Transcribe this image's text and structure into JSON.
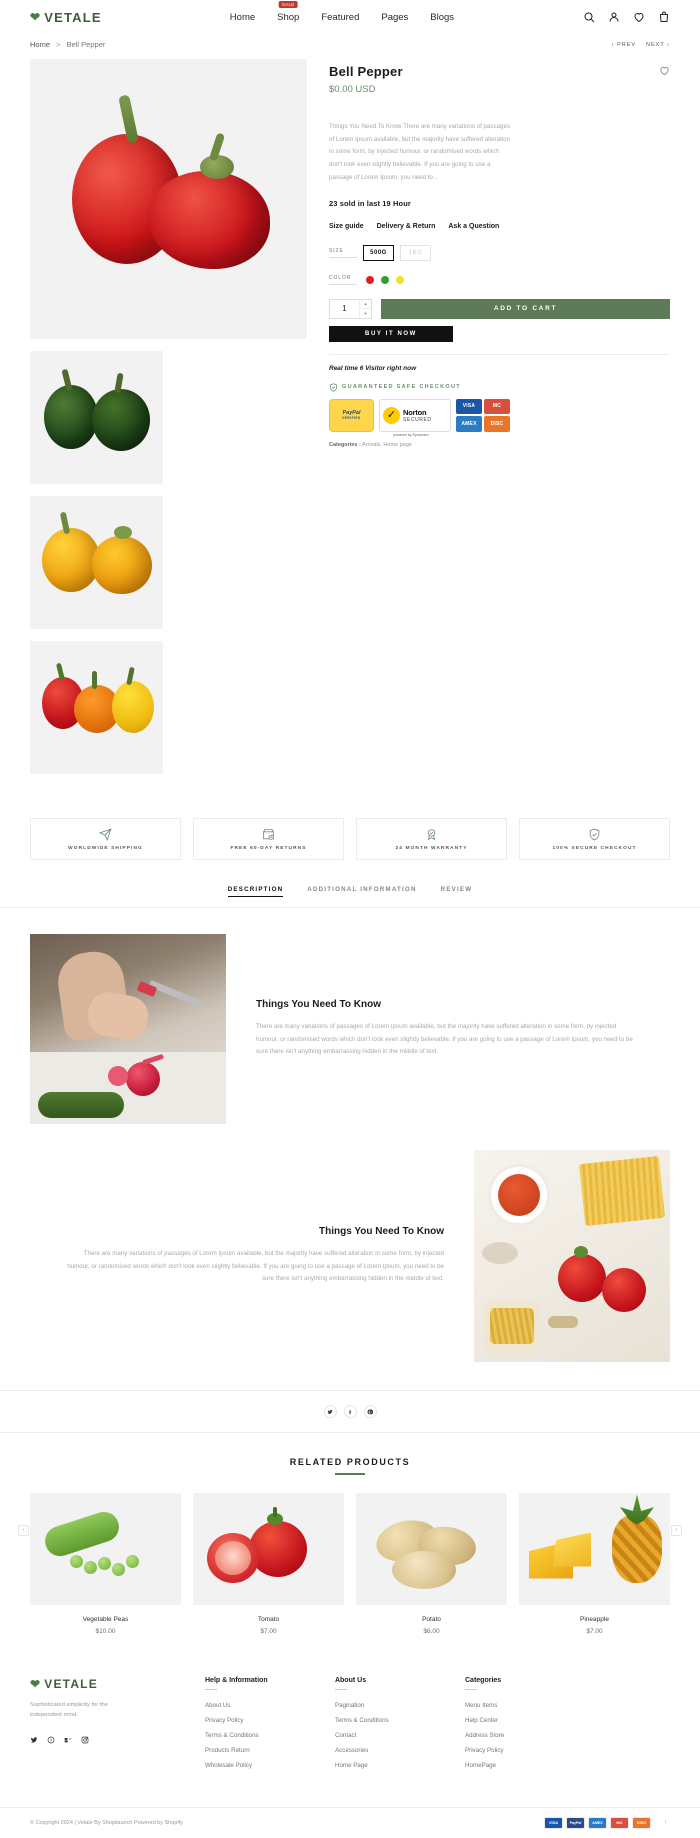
{
  "header": {
    "logo": "VETALE",
    "nav": [
      {
        "label": "Home",
        "badge": ""
      },
      {
        "label": "Shop",
        "badge": "SALE"
      },
      {
        "label": "Featured",
        "badge": ""
      },
      {
        "label": "Pages",
        "badge": ""
      },
      {
        "label": "Blogs",
        "badge": ""
      }
    ],
    "icons": [
      "search-icon",
      "account-icon",
      "wishlist-icon",
      "cart-icon"
    ]
  },
  "breadcrumb": {
    "home": "Home",
    "separator": ">",
    "current": "Bell Pepper",
    "prev": "PREV",
    "next": "NEXT"
  },
  "product": {
    "title": "Bell Pepper",
    "price": "$0.00 USD",
    "description": "Things You Need To Know There are many variations of passages of Lorem Ipsum available, but the majority have suffered alteration in some form, by injected humour, or randomised words which don't look even slightly believable. If you are going to use a passage of Lorem Ipsum, you need to...",
    "sold_text": "23 sold in last 19 Hour",
    "meta_links": [
      "Size guide",
      "Delivery & Return",
      "Ask a Question"
    ],
    "size_label": "SIZE",
    "sizes": [
      {
        "label": "500G",
        "selected": true
      },
      {
        "label": "1KG",
        "selected": false
      }
    ],
    "color_label": "COLOR",
    "colors": [
      "#e02020",
      "#2f9e2f",
      "#f2e029"
    ],
    "quantity": "1",
    "add_to_cart": "ADD TO CART",
    "buy_it_now": "BUY IT NOW",
    "realtime": "Real time 6 Visitor right now",
    "safe_checkout": "GUARANTEED SAFE CHECKOUT",
    "badges": {
      "paypal_line1": "PayPal",
      "paypal_line2": "VERIFIED",
      "norton_line1": "Norton",
      "norton_line2": "SECURED",
      "norton_powered": "powered by Symantec",
      "cards": [
        {
          "label": "VISA",
          "color": "#1a56a8"
        },
        {
          "label": "MC",
          "color": "#d94f3d"
        },
        {
          "label": "AMEX",
          "color": "#2b7cc4"
        },
        {
          "label": "DISC",
          "color": "#e8762a"
        }
      ]
    },
    "categories_label": "Categories :",
    "categories_value": "Arrivals, Home page"
  },
  "features": [
    {
      "icon": "paper-plane-icon",
      "label": "WORLDWIDE SHIPPING"
    },
    {
      "icon": "box-return-icon",
      "label": "FREE 60-DAY RETURNS"
    },
    {
      "icon": "warranty-badge-icon",
      "label": "24 MONTH WARRANTY"
    },
    {
      "icon": "shield-check-icon",
      "label": "100% SECURE CHECKOUT"
    }
  ],
  "tabs": [
    {
      "label": "DESCRIPTION",
      "active": true
    },
    {
      "label": "ADDITIONAL INFORMATION",
      "active": false
    },
    {
      "label": "REVIEW",
      "active": false
    }
  ],
  "description_blocks": [
    {
      "heading": "Things You Need To Know",
      "body": "There are many variations of passages of Lorem Ipsum available, but the majority have suffered alteration in some form, by injected humour, or randomised words which don't look even slightly believable. If you are going to use a passage of Lorem Ipsum, you need to be sure there isn't anything embarrassing hidden in the middle of text."
    },
    {
      "heading": "Things You Need To Know",
      "body": "There are many variations of passages of Lorem Ipsum available, but the majority have suffered alteration in some form, by injected humour, or randomised words which don't look even slightly believable. If you are going to use a passage of Lorem Ipsum, you need to be sure there isn't anything embarrassing hidden in the middle of text."
    }
  ],
  "social": [
    "twitter-icon",
    "facebook-icon",
    "pinterest-icon"
  ],
  "related": {
    "heading": "RELATED PRODUCTS",
    "prev_arrow": "‹",
    "next_arrow": "›",
    "items": [
      {
        "name": "Vegetable Peas",
        "price": "$10.00"
      },
      {
        "name": "Tomato",
        "price": "$7.00"
      },
      {
        "name": "Potato",
        "price": "$6.00"
      },
      {
        "name": "Pineapple",
        "price": "$7.00"
      }
    ]
  },
  "footer": {
    "logo": "VETALE",
    "tagline": "Sophisticated simplicity for the independent mind.",
    "socials": [
      "twitter-icon",
      "pinterest-icon",
      "behance-icon",
      "instagram-icon"
    ],
    "columns": [
      {
        "title": "Help & Information",
        "links": [
          "About Us",
          "Privacy Policy",
          "Terms & Conditions",
          "Products Return",
          "Wholesale Policy"
        ]
      },
      {
        "title": "About Us",
        "links": [
          "Pagination",
          "Terms & Conditions",
          "Contact",
          "Accessories",
          "Home Page"
        ]
      },
      {
        "title": "Categories",
        "links": [
          "Menu Items",
          "Help Center",
          "Address Store",
          "Privacy Policy",
          "HomePage"
        ]
      }
    ],
    "copyright": "© Copyright 2024 | Vetale By Shopilaunch Powered by Shopify",
    "payments": [
      {
        "label": "VISA",
        "color": "#1a56a8"
      },
      {
        "label": "PayPal",
        "color": "#2a4a8a"
      },
      {
        "label": "AMEX",
        "color": "#2b7cc4"
      },
      {
        "label": "MC",
        "color": "#d94f3d"
      },
      {
        "label": "DISC",
        "color": "#e8762a"
      }
    ],
    "to_top": "↑"
  }
}
